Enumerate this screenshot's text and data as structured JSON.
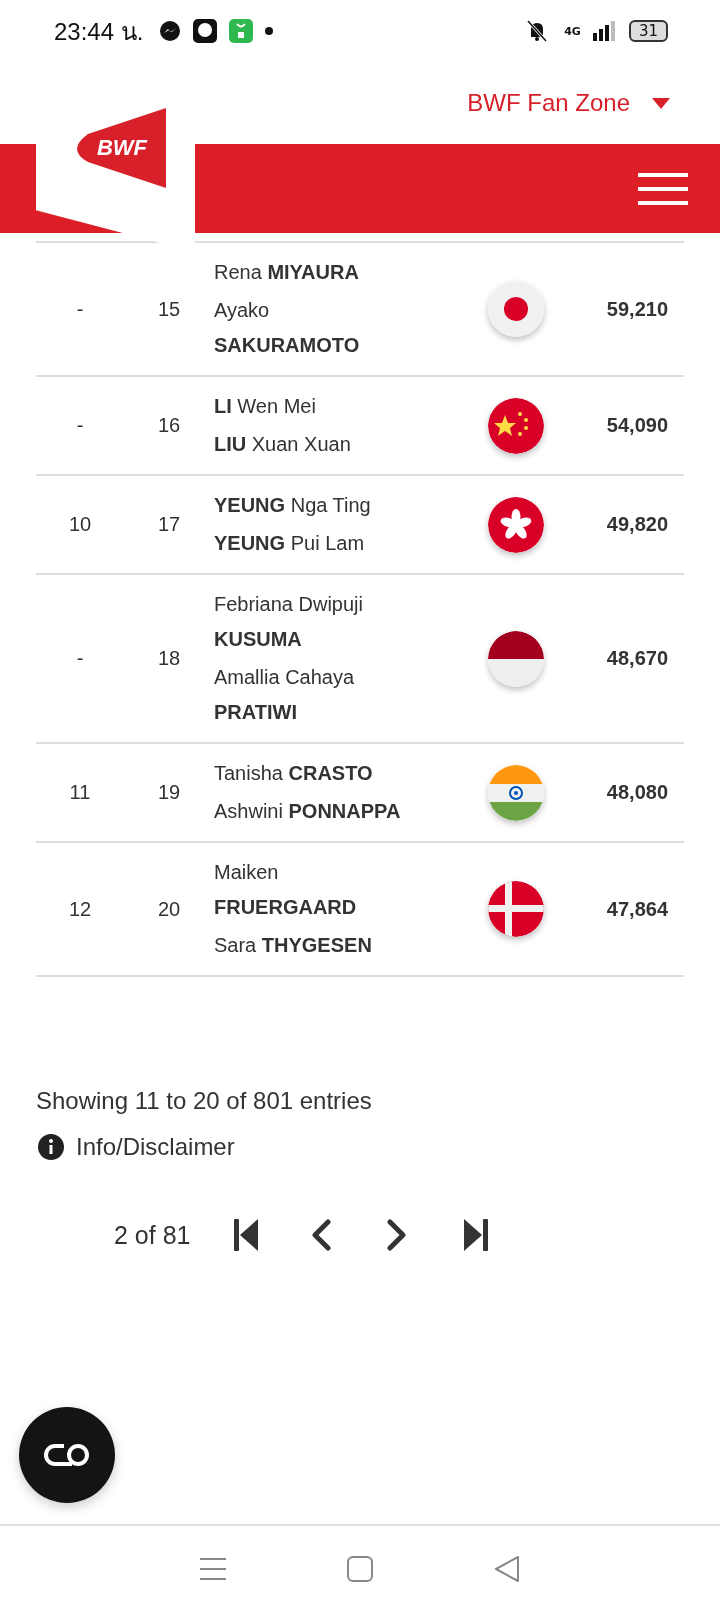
{
  "status_bar": {
    "time": "23:44 น.",
    "network": "4G",
    "battery": "31"
  },
  "header": {
    "logo": "BWF",
    "menu_label": "BWF Fan Zone"
  },
  "table": {
    "rows": [
      {
        "previous": "-",
        "rank": "15",
        "players": [
          "Rena **MIYAURA**",
          "Ayako **SAKURAMOTO**"
        ],
        "kind": "japan",
        "points": "59,210"
      },
      {
        "previous": "-",
        "rank": "16",
        "players": [
          "**LI** Wen Mei",
          "**LIU** Xuan Xuan"
        ],
        "kind": "china",
        "points": "54,090"
      },
      {
        "previous": "10",
        "rank": "17",
        "players": [
          "**YEUNG** Nga Ting",
          "**YEUNG** Pui Lam"
        ],
        "kind": "hong_kong",
        "points": "49,820"
      },
      {
        "previous": "-",
        "rank": "18",
        "players": [
          "Febriana Dwipuji **KUSUMA**",
          "Amallia Cahaya **PRATIWI**"
        ],
        "kind": "indonesia",
        "points": "48,670"
      },
      {
        "previous": "11",
        "rank": "19",
        "players": [
          "Tanisha **CRASTO**",
          "Ashwini **PONNAPPA**"
        ],
        "kind": "india",
        "points": "48,080"
      },
      {
        "previous": "12",
        "rank": "20",
        "players": [
          "Maiken **FRUERGAARD**",
          "Sara **THYGESEN**"
        ],
        "kind": "denmark",
        "points": "47,864"
      }
    ]
  },
  "footer": {
    "summary": "Showing 11 to 20 of 801 entries",
    "info_link": "Info/Disclaimer",
    "page_text": "2 of 81"
  }
}
